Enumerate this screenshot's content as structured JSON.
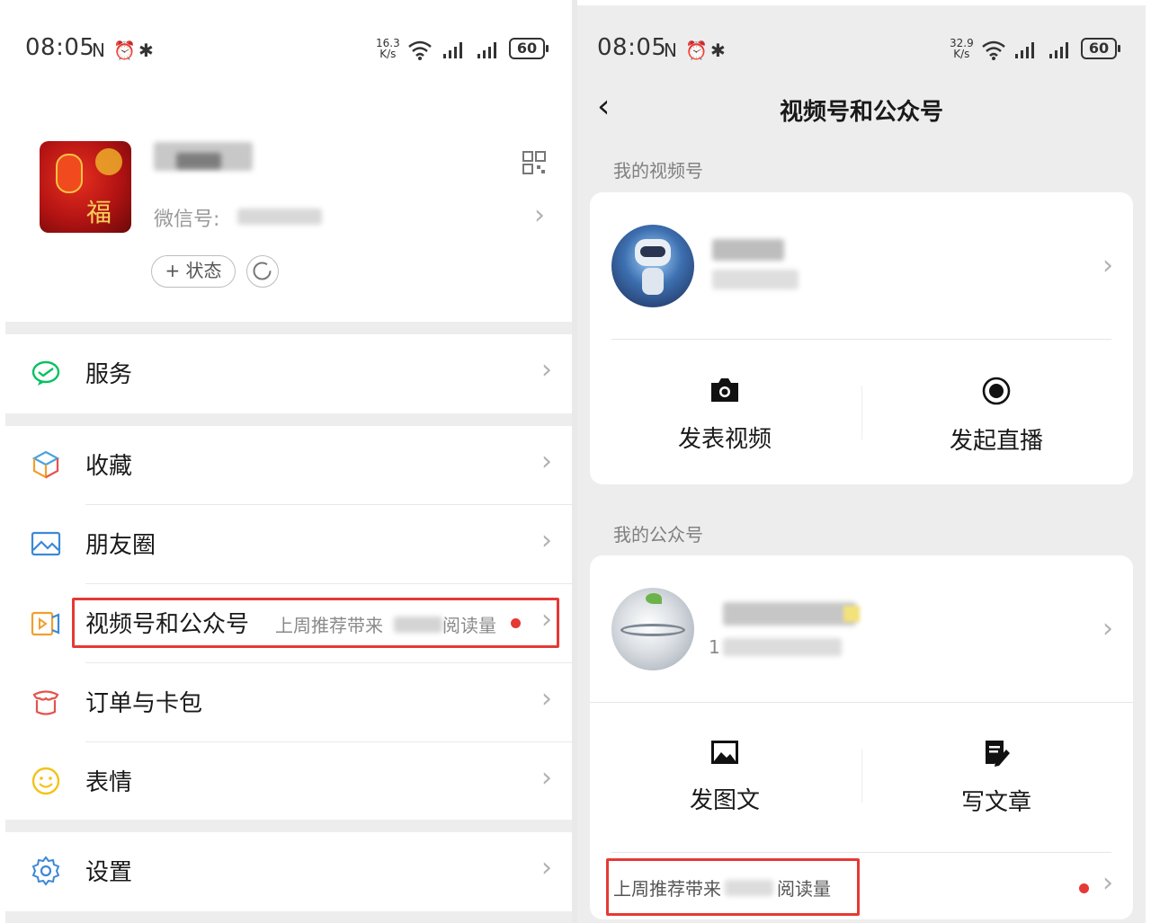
{
  "left": {
    "status": {
      "time": "08:05",
      "speed_value": "16.3",
      "speed_unit": "K/s",
      "battery": "60"
    },
    "profile": {
      "wechat_id_label": "微信号:",
      "status_button": "+ 状态"
    },
    "menu": [
      {
        "label": "服务",
        "icon": "wechat-pay-icon"
      },
      {
        "label": "收藏",
        "icon": "favorites-cube-icon"
      },
      {
        "label": "朋友圈",
        "icon": "moments-image-icon"
      },
      {
        "label": "视频号和公众号",
        "icon": "channels-icon",
        "subtitle": "上周推荐带来",
        "subtitle_suffix": "阅读量",
        "highlighted": true
      },
      {
        "label": "订单与卡包",
        "icon": "orders-icon"
      },
      {
        "label": "表情",
        "icon": "smiley-icon"
      },
      {
        "label": "设置",
        "icon": "gear-icon"
      }
    ]
  },
  "right": {
    "status": {
      "time": "08:05",
      "speed_value": "32.9",
      "speed_unit": "K/s",
      "battery": "60"
    },
    "nav": {
      "title": "视频号和公众号",
      "back_icon": "back-chevron-icon"
    },
    "channels": {
      "section_title": "我的视频号",
      "actions": [
        {
          "label": "发表视频",
          "icon": "camera-icon"
        },
        {
          "label": "发起直播",
          "icon": "live-record-icon"
        }
      ]
    },
    "official": {
      "section_title": "我的公众号",
      "followers_prefix": "1",
      "actions": [
        {
          "label": "发图文",
          "icon": "image-icon"
        },
        {
          "label": "写文章",
          "icon": "write-article-icon"
        }
      ],
      "recommend_prefix": "上周推荐带来",
      "recommend_suffix": "阅读量"
    }
  },
  "colors": {
    "highlight": "#e53935",
    "wechat_green": "#07c160",
    "badge_red": "#fa5151",
    "page_gray": "#ededed"
  }
}
